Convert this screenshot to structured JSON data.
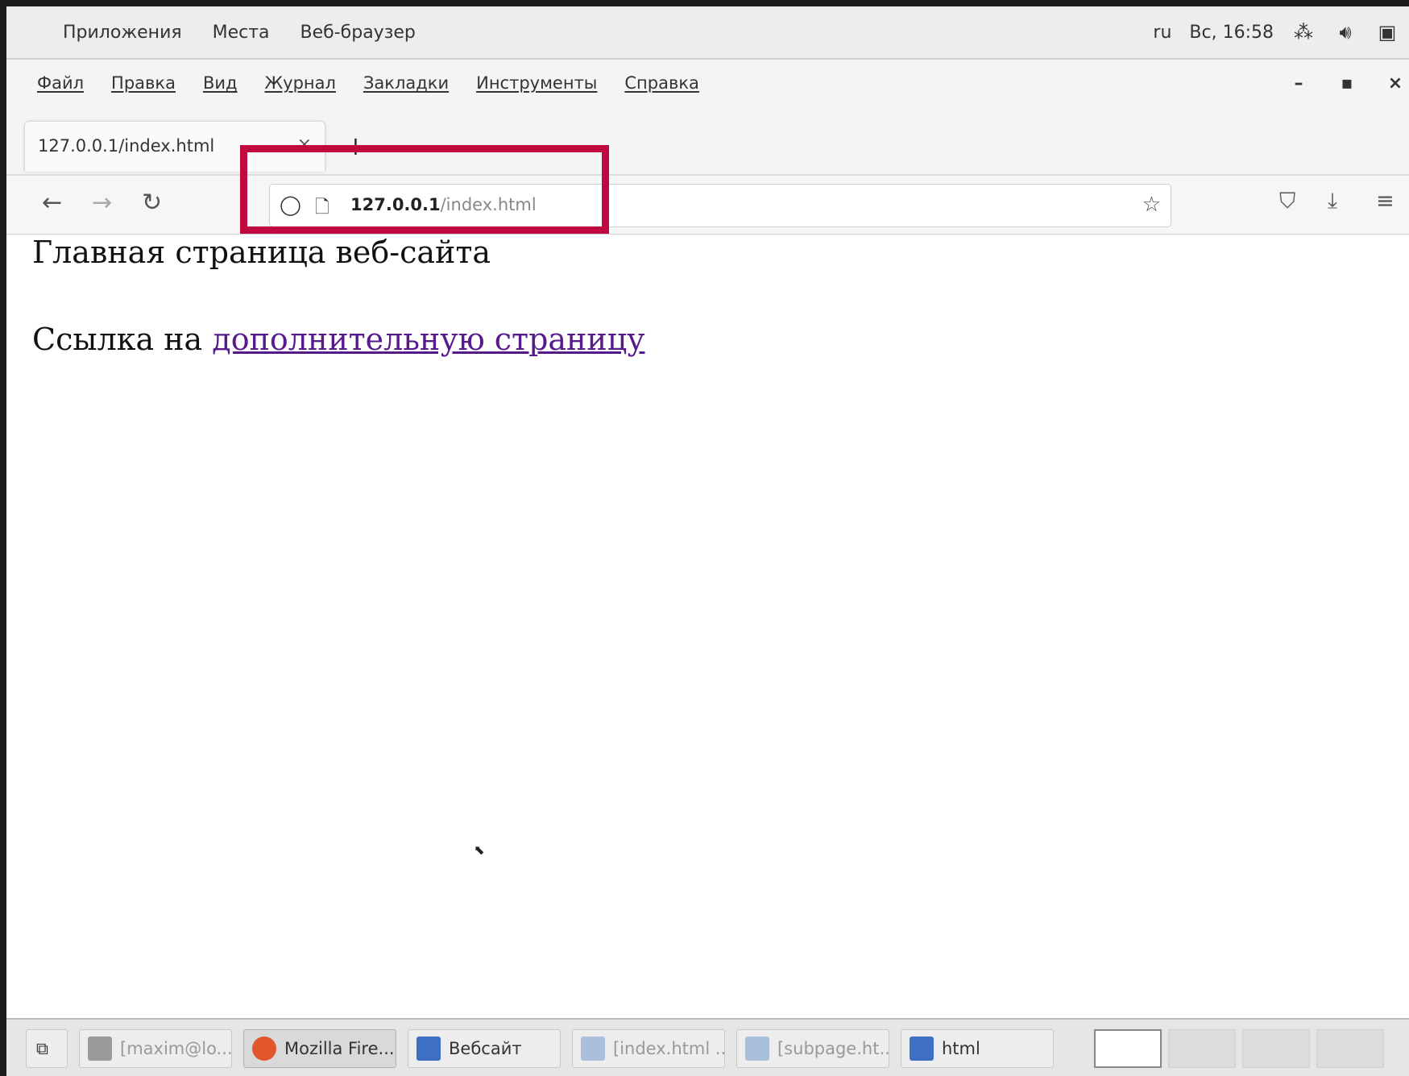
{
  "topbar": {
    "applications": "Приложения",
    "places": "Места",
    "app_name": "Веб-браузер",
    "lang": "ru",
    "clock": "Вс, 16:58",
    "icons": [
      "network-icon",
      "volume-icon",
      "battery-icon"
    ]
  },
  "menubar": {
    "items": [
      "Файл",
      "Правка",
      "Вид",
      "Журнал",
      "Закладки",
      "Инструменты",
      "Справка"
    ],
    "minimize": "–",
    "maximize": "▪",
    "close": "×"
  },
  "tabs": [
    {
      "title": "127.0.0.1/index.html",
      "close": "×"
    }
  ],
  "new_tab": "+",
  "navbar": {
    "back": "←",
    "forward": "→",
    "reload": "↻",
    "url_host": "127.0.0.1",
    "url_path": "/index.html",
    "bookmark_star": "☆",
    "pocket": "⛉",
    "download": "⤓",
    "menu": "≡"
  },
  "page": {
    "heading": "Главная страница веб-сайта",
    "link_prefix": "Ссылка на ",
    "link_text": "дополнительную страницу"
  },
  "taskbar": {
    "show_desktop": "⧉",
    "tasks": [
      {
        "label": "[maxim@lo...",
        "icon_color": "#9a9a9a",
        "state": "dim"
      },
      {
        "label": "Mozilla Fire...",
        "icon_color": "#e2562b",
        "state": "active"
      },
      {
        "label": "Вебсайт",
        "icon_color": "#3d6fc4",
        "state": "normal"
      },
      {
        "label": "[index.html ...",
        "icon_color": "#a9bfdc",
        "state": "dim"
      },
      {
        "label": "[subpage.ht...",
        "icon_color": "#a9bfdc",
        "state": "dim"
      },
      {
        "label": "html",
        "icon_color": "#3d6fc4",
        "state": "normal"
      }
    ]
  },
  "colors": {
    "highlight": "#c1093f",
    "visited_link": "#551a8b"
  }
}
